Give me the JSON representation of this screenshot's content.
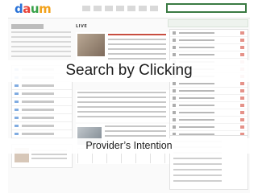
{
  "overlay": {
    "headline": "Search by Clicking",
    "subheadline": "Provider’s Intention"
  },
  "background_page": {
    "logo": {
      "letters": [
        "d",
        "a",
        "u",
        "m"
      ]
    },
    "live_tag": "LIVE",
    "colors": {
      "logo_blue": "#2a73d8",
      "logo_red": "#e8433a",
      "logo_green": "#38a24a",
      "logo_orange": "#f2a21b",
      "search_border": "#3a7a43"
    }
  }
}
